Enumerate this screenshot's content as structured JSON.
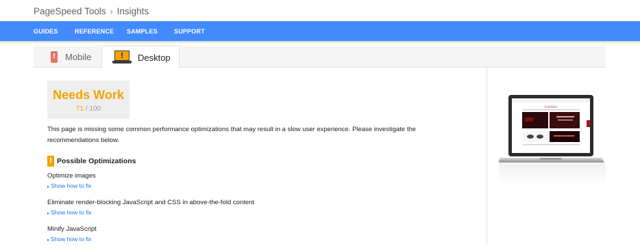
{
  "breadcrumb": {
    "root": "PageSpeed Tools",
    "separator": "›",
    "current": "Insights"
  },
  "nav": {
    "items": [
      "GUIDES",
      "REFERENCE",
      "SAMPLES",
      "SUPPORT"
    ]
  },
  "tabs": {
    "mobile": "Mobile",
    "desktop": "Desktop",
    "active": "desktop"
  },
  "score": {
    "verdict": "Needs Work",
    "value": "71",
    "divider": " / ",
    "max": "100"
  },
  "summary": "This page is missing some common performance optimizations that may result in a slow user experience. Please investigate the recommendations below.",
  "optimizations": {
    "heading": "Possible Optimizations",
    "items": [
      {
        "title": "Optimize images",
        "link": "Show how to fix"
      },
      {
        "title": "Eliminate render-blocking JavaScript and CSS in above-the-fold content",
        "link": "Show how to fix"
      },
      {
        "title": "Minify JavaScript",
        "link": "Show how to fix"
      }
    ]
  },
  "preview": {
    "site_logo_text": "Cartier"
  },
  "colors": {
    "nav_blue": "#448aff",
    "warning_orange": "#f4a300",
    "link_blue": "#1a73e8",
    "mobile_red": "#e57368"
  },
  "icons": {
    "breadcrumb_separator": "chevron-right-icon",
    "mobile_tab": "mobile-phone-icon",
    "desktop_tab": "laptop-icon",
    "optimizations": "warning-icon"
  }
}
